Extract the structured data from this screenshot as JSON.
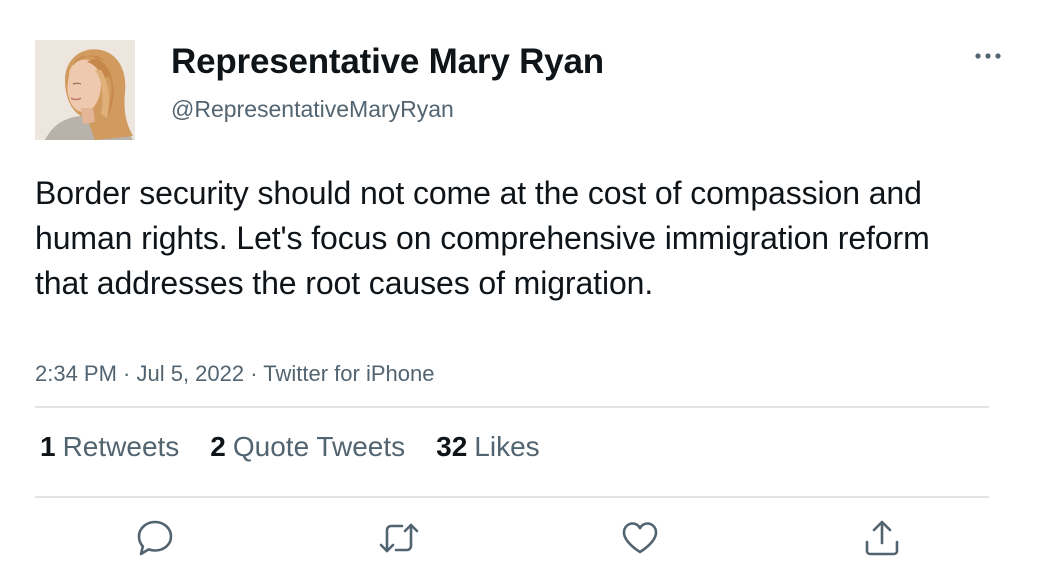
{
  "tweet": {
    "display_name": "Representative Mary Ryan",
    "handle": "@RepresentativeMaryRyan",
    "text": "Border security should not come at the cost of compassion and human rights. Let's focus on comprehensive immigration reform that addresses the root causes of migration.",
    "meta": "2:34 PM · Jul 5, 2022 · Twitter for iPhone",
    "stats": {
      "retweets_count": "1",
      "retweets_label": "Retweets",
      "quotes_count": "2",
      "quotes_label": "Quote Tweets",
      "likes_count": "32",
      "likes_label": "Likes"
    }
  },
  "icons": {
    "more": "more-horizontal-icon",
    "reply": "reply-bubble-icon",
    "retweet": "retweet-arrows-icon",
    "like": "heart-icon",
    "share": "share-upload-icon"
  },
  "colors": {
    "text": "#0f1419",
    "secondary": "#536471",
    "divider": "#e1e4e7",
    "icon": "#536471"
  }
}
